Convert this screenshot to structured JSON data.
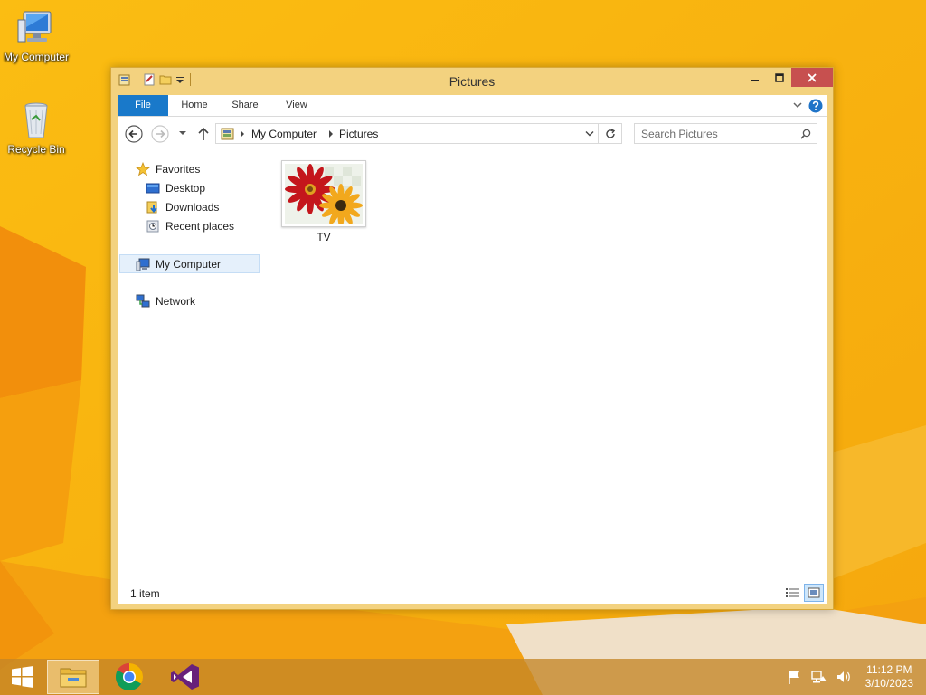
{
  "desktop": {
    "icons": [
      {
        "label": "My Computer",
        "icon": "computer-icon"
      },
      {
        "label": "Recycle Bin",
        "icon": "recycle-bin-icon"
      }
    ]
  },
  "window": {
    "title": "Pictures",
    "ribbon": {
      "tabs": [
        "File",
        "Home",
        "Share",
        "View"
      ],
      "active_tab": "File"
    },
    "address": {
      "breadcrumbs": [
        "My Computer",
        "Pictures"
      ]
    },
    "search": {
      "placeholder": "Search Pictures"
    },
    "nav_pane": {
      "favorites_label": "Favorites",
      "favorites": [
        "Desktop",
        "Downloads",
        "Recent places"
      ],
      "my_computer_label": "My Computer",
      "network_label": "Network",
      "selected": "My Computer"
    },
    "files": [
      {
        "name": "TV",
        "type": "picture-folder"
      }
    ],
    "status": {
      "item_count": "1 item",
      "view_mode": "large-icons"
    }
  },
  "taskbar": {
    "apps": [
      "File Explorer",
      "Google Chrome",
      "Visual Studio"
    ],
    "active_app": "File Explorer",
    "clock": {
      "time": "11:12 PM",
      "date": "3/10/2023"
    }
  },
  "colors": {
    "wallpaper": "#f7b00f",
    "window_frame": "#f3d27f",
    "file_tab": "#1979ca",
    "close_button": "#c7504f",
    "selection": "#e5f0fb"
  }
}
